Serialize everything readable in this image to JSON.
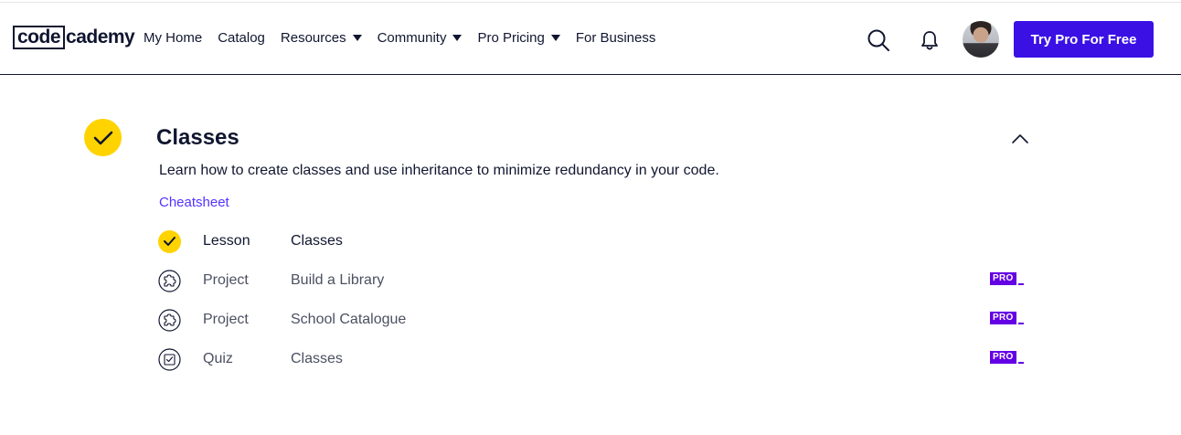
{
  "brand": {
    "logo_left": "code",
    "logo_right": "cademy"
  },
  "nav": {
    "items": [
      {
        "label": "My Home",
        "has_caret": false
      },
      {
        "label": "Catalog",
        "has_caret": false
      },
      {
        "label": "Resources",
        "has_caret": true
      },
      {
        "label": "Community",
        "has_caret": true
      },
      {
        "label": "Pro Pricing",
        "has_caret": true
      },
      {
        "label": "For Business",
        "has_caret": false
      }
    ]
  },
  "header_actions": {
    "search_icon": "search-icon",
    "bell_icon": "bell-icon",
    "try_pro_label": "Try Pro For Free"
  },
  "section": {
    "title": "Classes",
    "description": "Learn how to create classes and use inheritance to minimize redundancy in your code.",
    "cheatsheet_label": "Cheatsheet",
    "completed": true,
    "items": [
      {
        "type": "Lesson",
        "name": "Classes",
        "status": "completed",
        "pro": false
      },
      {
        "type": "Project",
        "name": "Build a Library",
        "status": "locked",
        "pro": true,
        "badge": "PRO"
      },
      {
        "type": "Project",
        "name": "School Catalogue",
        "status": "locked",
        "pro": true,
        "badge": "PRO"
      },
      {
        "type": "Quiz",
        "name": "Classes",
        "status": "locked",
        "pro": true,
        "badge": "PRO"
      }
    ]
  },
  "colors": {
    "brand_purple": "#3a10e5",
    "pro_badge": "#6400e4",
    "check_yellow": "#ffd300",
    "link_purple": "#5533ff",
    "navy": "#10162f"
  }
}
